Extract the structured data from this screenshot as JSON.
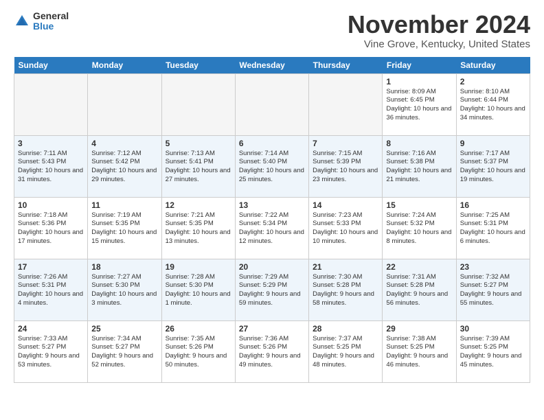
{
  "header": {
    "logo_general": "General",
    "logo_blue": "Blue",
    "month_title": "November 2024",
    "location": "Vine Grove, Kentucky, United States"
  },
  "days_of_week": [
    "Sunday",
    "Monday",
    "Tuesday",
    "Wednesday",
    "Thursday",
    "Friday",
    "Saturday"
  ],
  "weeks": [
    [
      {
        "day": "",
        "info": ""
      },
      {
        "day": "",
        "info": ""
      },
      {
        "day": "",
        "info": ""
      },
      {
        "day": "",
        "info": ""
      },
      {
        "day": "",
        "info": ""
      },
      {
        "day": "1",
        "info": "Sunrise: 8:09 AM\nSunset: 6:45 PM\nDaylight: 10 hours and 36 minutes."
      },
      {
        "day": "2",
        "info": "Sunrise: 8:10 AM\nSunset: 6:44 PM\nDaylight: 10 hours and 34 minutes."
      }
    ],
    [
      {
        "day": "3",
        "info": "Sunrise: 7:11 AM\nSunset: 5:43 PM\nDaylight: 10 hours and 31 minutes."
      },
      {
        "day": "4",
        "info": "Sunrise: 7:12 AM\nSunset: 5:42 PM\nDaylight: 10 hours and 29 minutes."
      },
      {
        "day": "5",
        "info": "Sunrise: 7:13 AM\nSunset: 5:41 PM\nDaylight: 10 hours and 27 minutes."
      },
      {
        "day": "6",
        "info": "Sunrise: 7:14 AM\nSunset: 5:40 PM\nDaylight: 10 hours and 25 minutes."
      },
      {
        "day": "7",
        "info": "Sunrise: 7:15 AM\nSunset: 5:39 PM\nDaylight: 10 hours and 23 minutes."
      },
      {
        "day": "8",
        "info": "Sunrise: 7:16 AM\nSunset: 5:38 PM\nDaylight: 10 hours and 21 minutes."
      },
      {
        "day": "9",
        "info": "Sunrise: 7:17 AM\nSunset: 5:37 PM\nDaylight: 10 hours and 19 minutes."
      }
    ],
    [
      {
        "day": "10",
        "info": "Sunrise: 7:18 AM\nSunset: 5:36 PM\nDaylight: 10 hours and 17 minutes."
      },
      {
        "day": "11",
        "info": "Sunrise: 7:19 AM\nSunset: 5:35 PM\nDaylight: 10 hours and 15 minutes."
      },
      {
        "day": "12",
        "info": "Sunrise: 7:21 AM\nSunset: 5:35 PM\nDaylight: 10 hours and 13 minutes."
      },
      {
        "day": "13",
        "info": "Sunrise: 7:22 AM\nSunset: 5:34 PM\nDaylight: 10 hours and 12 minutes."
      },
      {
        "day": "14",
        "info": "Sunrise: 7:23 AM\nSunset: 5:33 PM\nDaylight: 10 hours and 10 minutes."
      },
      {
        "day": "15",
        "info": "Sunrise: 7:24 AM\nSunset: 5:32 PM\nDaylight: 10 hours and 8 minutes."
      },
      {
        "day": "16",
        "info": "Sunrise: 7:25 AM\nSunset: 5:31 PM\nDaylight: 10 hours and 6 minutes."
      }
    ],
    [
      {
        "day": "17",
        "info": "Sunrise: 7:26 AM\nSunset: 5:31 PM\nDaylight: 10 hours and 4 minutes."
      },
      {
        "day": "18",
        "info": "Sunrise: 7:27 AM\nSunset: 5:30 PM\nDaylight: 10 hours and 3 minutes."
      },
      {
        "day": "19",
        "info": "Sunrise: 7:28 AM\nSunset: 5:30 PM\nDaylight: 10 hours and 1 minute."
      },
      {
        "day": "20",
        "info": "Sunrise: 7:29 AM\nSunset: 5:29 PM\nDaylight: 9 hours and 59 minutes."
      },
      {
        "day": "21",
        "info": "Sunrise: 7:30 AM\nSunset: 5:28 PM\nDaylight: 9 hours and 58 minutes."
      },
      {
        "day": "22",
        "info": "Sunrise: 7:31 AM\nSunset: 5:28 PM\nDaylight: 9 hours and 56 minutes."
      },
      {
        "day": "23",
        "info": "Sunrise: 7:32 AM\nSunset: 5:27 PM\nDaylight: 9 hours and 55 minutes."
      }
    ],
    [
      {
        "day": "24",
        "info": "Sunrise: 7:33 AM\nSunset: 5:27 PM\nDaylight: 9 hours and 53 minutes."
      },
      {
        "day": "25",
        "info": "Sunrise: 7:34 AM\nSunset: 5:27 PM\nDaylight: 9 hours and 52 minutes."
      },
      {
        "day": "26",
        "info": "Sunrise: 7:35 AM\nSunset: 5:26 PM\nDaylight: 9 hours and 50 minutes."
      },
      {
        "day": "27",
        "info": "Sunrise: 7:36 AM\nSunset: 5:26 PM\nDaylight: 9 hours and 49 minutes."
      },
      {
        "day": "28",
        "info": "Sunrise: 7:37 AM\nSunset: 5:25 PM\nDaylight: 9 hours and 48 minutes."
      },
      {
        "day": "29",
        "info": "Sunrise: 7:38 AM\nSunset: 5:25 PM\nDaylight: 9 hours and 46 minutes."
      },
      {
        "day": "30",
        "info": "Sunrise: 7:39 AM\nSunset: 5:25 PM\nDaylight: 9 hours and 45 minutes."
      }
    ]
  ]
}
